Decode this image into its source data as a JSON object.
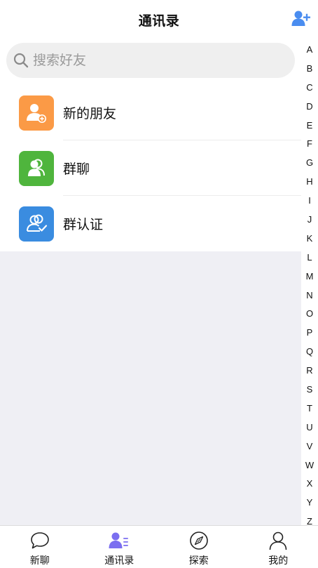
{
  "header": {
    "title": "通讯录",
    "add_icon": "add-friend-icon",
    "accent_color": "#4a8df0"
  },
  "search": {
    "placeholder": "搜索好友",
    "value": ""
  },
  "entries": [
    {
      "label": "新的朋友",
      "icon": "new-friend-icon",
      "color": "#fb9a46"
    },
    {
      "label": "群聊",
      "icon": "group-chat-icon",
      "color": "#4fb53d"
    },
    {
      "label": "群认证",
      "icon": "group-verify-icon",
      "color": "#3a8ce0"
    }
  ],
  "alphabet": [
    "A",
    "B",
    "C",
    "D",
    "E",
    "F",
    "G",
    "H",
    "I",
    "J",
    "K",
    "L",
    "M",
    "N",
    "O",
    "P",
    "Q",
    "R",
    "S",
    "T",
    "U",
    "V",
    "W",
    "X",
    "Y",
    "Z"
  ],
  "tabbar": {
    "active_color": "#7b6ff0",
    "tabs": [
      {
        "label": "新聊",
        "icon": "chat-bubble-icon"
      },
      {
        "label": "通讯录",
        "icon": "contacts-icon"
      },
      {
        "label": "探索",
        "icon": "compass-icon"
      },
      {
        "label": "我的",
        "icon": "profile-icon"
      }
    ]
  }
}
